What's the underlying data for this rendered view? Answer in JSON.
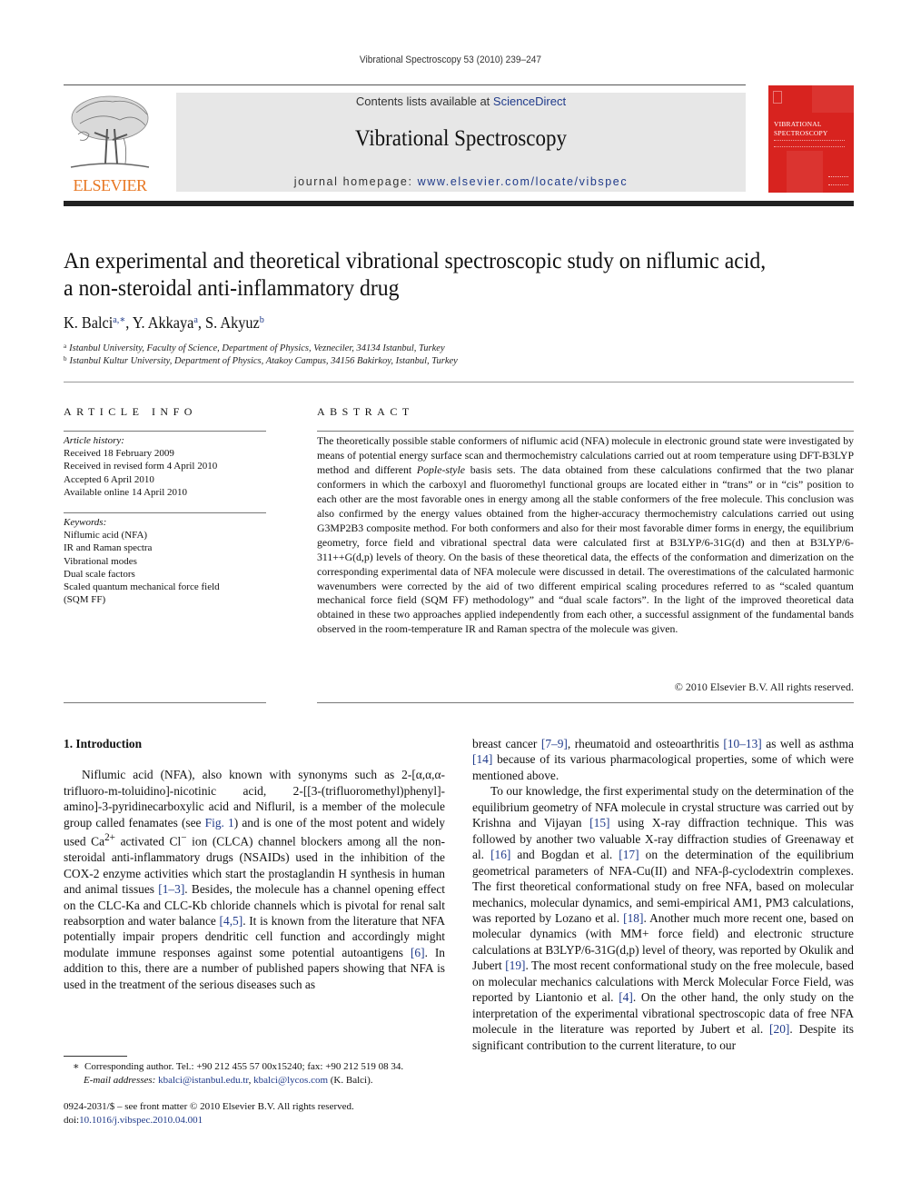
{
  "running_header": "Vibrational Spectroscopy 53 (2010) 239–247",
  "masthead": {
    "publisher_logo_text": "ELSEVIER",
    "contents_prefix": "Contents lists available at ",
    "contents_link": "ScienceDirect",
    "journal_title": "Vibrational Spectroscopy",
    "homepage_prefix": "journal homepage: ",
    "homepage_link": "www.elsevier.com/locate/vibspec",
    "cover_title_line1": "VIBRATIONAL",
    "cover_title_line2": "SPECTROSCOPY",
    "brand_color": "#e87722",
    "cover_color": "#d8231f"
  },
  "article": {
    "title_line1": "An experimental and theoretical vibrational spectroscopic study on niflumic acid,",
    "title_line2": "a non-steroidal anti-inflammatory drug",
    "authors": [
      {
        "name": "K. Balci",
        "sup": "a,∗"
      },
      {
        "name": "Y. Akkaya",
        "sup": "a"
      },
      {
        "name": "S. Akyuz",
        "sup": "b"
      }
    ],
    "affiliations": [
      {
        "mark": "a",
        "text": "Istanbul University, Faculty of Science, Department of Physics, Vezneciler, 34134 Istanbul, Turkey"
      },
      {
        "mark": "b",
        "text": "Istanbul Kultur University, Department of Physics, Atakoy Campus, 34156 Bakirkoy, Istanbul, Turkey"
      }
    ]
  },
  "article_info": {
    "heading": "ARTICLE INFO",
    "history_label": "Article history:",
    "history": [
      "Received 18 February 2009",
      "Received in revised form 4 April 2010",
      "Accepted 6 April 2010",
      "Available online 14 April 2010"
    ],
    "keywords_label": "Keywords:",
    "keywords": [
      "Niflumic acid (NFA)",
      "IR and Raman spectra",
      "Vibrational modes",
      "Dual scale factors",
      "Scaled quantum mechanical force field",
      "(SQM FF)"
    ]
  },
  "abstract": {
    "heading": "ABSTRACT",
    "text_part1": "The theoretically possible stable conformers of niflumic acid (NFA) molecule in electronic ground state were investigated by means of potential energy surface scan and thermochemistry calculations carried out at room temperature using DFT-B3LYP method and different ",
    "text_italic": "Pople-style",
    "text_part2": " basis sets. The data obtained from these calculations confirmed that the two planar conformers in which the carboxyl and fluoromethyl functional groups are located either in “trans” or in “cis” position to each other are the most favorable ones in energy among all the stable conformers of the free molecule. This conclusion was also confirmed by the energy values obtained from the higher-accuracy thermochemistry calculations carried out using G3MP2B3 composite method. For both conformers and also for their most favorable dimer forms in energy, the equilibrium geometry, force field and vibrational spectral data were calculated first at B3LYP/6-31G(d) and then at B3LYP/6-311++G(d,p) levels of theory. On the basis of these theoretical data, the effects of the conformation and dimerization on the corresponding experimental data of NFA molecule were discussed in detail. The overestimations of the calculated harmonic wavenumbers were corrected by the aid of two different empirical scaling procedures referred to as “scaled quantum mechanical force field (SQM FF) methodology” and “dual scale factors”. In the light of the improved theoretical data obtained in these two approaches applied independently from each other, a successful assignment of the fundamental bands observed in the room-temperature IR and Raman spectra of the molecule was given.",
    "copyright": "© 2010 Elsevier B.V. All rights reserved."
  },
  "body": {
    "section_heading": "1.  Introduction",
    "left_col": {
      "p1_a": "Niflumic acid (NFA), also known with synonyms such as 2-[α,α,α-trifluoro-m-toluidino]-nicotinic acid, 2-[[3-(trifluoromethyl)phenyl]-amino]-3-pyridinecarboxylic acid and Nifluril, is a member of the molecule group called fenamates (see ",
      "ref_fig1": "Fig. 1",
      "p1_b": ") and is one of the most potent and widely used Ca",
      "sup_ca": "2+",
      "p1_c": " activated Cl",
      "sup_cl": "−",
      "p1_d": " ion (CLCA) channel blockers among all the non-steroidal anti-inflammatory drugs (NSAIDs) used in the inhibition of the COX-2 enzyme activities which start the prostaglandin H synthesis in human and animal tissues ",
      "ref_1_3": "[1–3]",
      "p1_e": ". Besides, the molecule has a channel opening effect on the CLC-Ka and CLC-Kb chloride channels which is pivotal for renal salt reabsorption and water balance ",
      "ref_4_5": "[4,5]",
      "p1_f": ". It is known from the literature that NFA potentially impair propers dendritic cell function and accordingly might modulate immune responses against some potential autoantigens ",
      "ref_6": "[6]",
      "p1_g": ". In addition to this, there are a number of published papers showing that NFA is used in the treatment of the serious diseases such as"
    },
    "right_col": {
      "p1_a": "breast cancer ",
      "ref_7_9": "[7–9]",
      "p1_b": ", rheumatoid and osteoarthritis ",
      "ref_10_13": "[10–13]",
      "p1_c": " as well as asthma ",
      "ref_14": "[14]",
      "p1_d": " because of its various pharmacological properties, some of which were mentioned above.",
      "p2_a": "To our knowledge, the first experimental study on the determination of the equilibrium geometry of NFA molecule in crystal structure was carried out by Krishna and Vijayan ",
      "ref_15": "[15]",
      "p2_b": " using X-ray diffraction technique. This was followed by another two valuable X-ray diffraction studies of Greenaway et al. ",
      "ref_16": "[16]",
      "p2_c": " and Bogdan et al. ",
      "ref_17": "[17]",
      "p2_d": " on the determination of the equilibrium geometrical parameters of NFA-Cu(II) and NFA-β-cyclodextrin complexes. The first theoretical conformational study on free NFA, based on molecular mechanics, molecular dynamics, and semi-empirical AM1, PM3 calculations, was reported by Lozano et al. ",
      "ref_18": "[18]",
      "p2_e": ". Another much more recent one, based on molecular dynamics (with MM+ force field) and electronic structure calculations at B3LYP/6-31G(d,p) level of theory, was reported by Okulik and Jubert ",
      "ref_19": "[19]",
      "p2_f": ". The most recent conformational study on the free molecule, based on molecular mechanics calculations with Merck Molecular Force Field, was reported by Liantonio et al. ",
      "ref_4": "[4]",
      "p2_g": ". On the other hand, the only study on the interpretation of the experimental vibrational spectroscopic data of free NFA molecule in the literature was reported by Jubert et al. ",
      "ref_20": "[20]",
      "p2_h": ". Despite its significant contribution to the current literature, to our"
    }
  },
  "footnote": {
    "mark": "∗",
    "corresponding": "Corresponding author. Tel.: +90 212 455 57 00x15240; fax: +90 212 519 08 34.",
    "email_label": "E-mail addresses:",
    "email1": "kbalci@istanbul.edu.tr",
    "email2": "kbalci@lycos.com",
    "email_suffix": " (K. Balci)."
  },
  "front_matter": {
    "issn_line": "0924-2031/$ – see front matter © 2010 Elsevier B.V. All rights reserved.",
    "doi_prefix": "doi:",
    "doi": "10.1016/j.vibspec.2010.04.001"
  }
}
